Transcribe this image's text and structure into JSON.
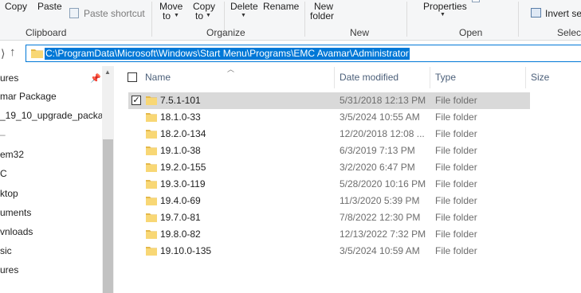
{
  "ribbon": {
    "copy": "Copy",
    "paste": "Paste",
    "paste_shortcut": "Paste shortcut",
    "move_to": "Move",
    "move_to_2": "to",
    "copy_to": "Copy",
    "copy_to_2": "to",
    "delete": "Delete",
    "rename": "Rename",
    "new_folder": "New",
    "new_folder_2": "folder",
    "properties": "Properties",
    "invert_selection": "Invert sel",
    "groups": {
      "clipboard": "Clipboard",
      "organize": "Organize",
      "new": "New",
      "open": "Open",
      "select": "Select"
    }
  },
  "address": {
    "path": "C:\\ProgramData\\Microsoft\\Windows\\Start Menu\\Programs\\EMC Avamar\\Administrator"
  },
  "nav_pane": {
    "items": [
      "ures",
      "mar Package",
      "_19_10_upgrade_packag",
      "",
      "em32",
      "C",
      "ktop",
      "uments",
      "vnloads",
      "sic",
      "ures"
    ]
  },
  "columns": {
    "name": "Name",
    "date": "Date modified",
    "type": "Type",
    "size": "Size"
  },
  "files": [
    {
      "name": "7.5.1-101",
      "date": "5/31/2018 12:13 PM",
      "type": "File folder"
    },
    {
      "name": "18.1.0-33",
      "date": "3/5/2024 10:55 AM",
      "type": "File folder"
    },
    {
      "name": "18.2.0-134",
      "date": "12/20/2018 12:08 ...",
      "type": "File folder"
    },
    {
      "name": "19.1.0-38",
      "date": "6/3/2019 7:13 PM",
      "type": "File folder"
    },
    {
      "name": "19.2.0-155",
      "date": "3/2/2020 6:47 PM",
      "type": "File folder"
    },
    {
      "name": "19.3.0-119",
      "date": "5/28/2020 10:16 PM",
      "type": "File folder"
    },
    {
      "name": "19.4.0-69",
      "date": "11/3/2020 5:39 PM",
      "type": "File folder"
    },
    {
      "name": "19.7.0-81",
      "date": "7/8/2022 12:30 PM",
      "type": "File folder"
    },
    {
      "name": "19.8.0-82",
      "date": "12/13/2022 7:32 PM",
      "type": "File folder"
    },
    {
      "name": "19.10.0-135",
      "date": "3/5/2024 10:59 AM",
      "type": "File folder"
    }
  ],
  "selected_row": 0,
  "colors": {
    "folder_yellow": "#f8d775",
    "folder_shade": "#e4b84a",
    "selection_bg": "#d9d9d9",
    "address_highlight": "#0078d7"
  },
  "icons": [
    "folder-icon",
    "back-arrow-icon",
    "up-arrow-icon",
    "pin-icon",
    "checkbox-icon",
    "chevron-up-icon",
    "paste-shortcut-icon",
    "invert-selection-icon"
  ]
}
